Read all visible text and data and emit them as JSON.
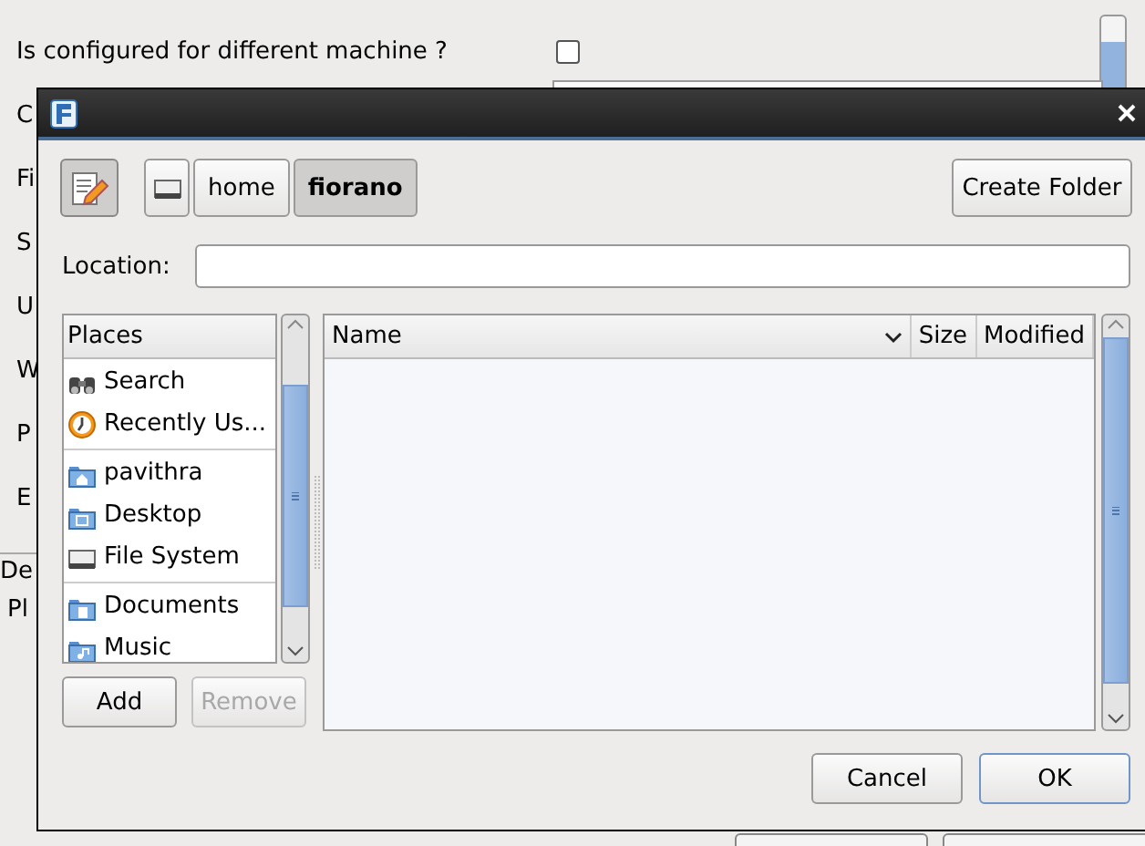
{
  "background": {
    "rows": [
      {
        "label": "Is configured for different machine ?",
        "kind": "checkbox",
        "checked": false
      },
      {
        "label": "C",
        "kind": "text"
      },
      {
        "label": "Fi",
        "kind": "text"
      },
      {
        "label": "S",
        "kind": "text"
      },
      {
        "label": "U",
        "kind": "text"
      },
      {
        "label": "W",
        "kind": "text"
      },
      {
        "label": "P",
        "kind": "text"
      },
      {
        "label": "E",
        "kind": "text"
      }
    ],
    "section_labels": [
      "De",
      "Pl"
    ]
  },
  "dialog": {
    "toolbar": {
      "edit_toggle": {
        "pressed": true
      },
      "path": [
        {
          "kind": "drive",
          "selected": false
        },
        {
          "kind": "text",
          "label": "home",
          "selected": false
        },
        {
          "kind": "text",
          "label": "fiorano",
          "selected": true
        }
      ],
      "create_folder": "Create Folder"
    },
    "location": {
      "label": "Location:"
    },
    "places": {
      "header": "Places",
      "groups": [
        [
          {
            "label": "Search",
            "kind": "search"
          },
          {
            "label": "Recently Us...",
            "kind": "recent"
          }
        ],
        [
          {
            "label": "pavithra",
            "kind": "home-folder"
          },
          {
            "label": "Desktop",
            "kind": "desktop-folder"
          },
          {
            "label": "File System",
            "kind": "drive"
          }
        ],
        [
          {
            "label": "Documents",
            "kind": "documents-folder"
          },
          {
            "label": "Music",
            "kind": "music-folder"
          }
        ]
      ]
    },
    "place_buttons": [
      {
        "label": "Add",
        "disabled": false
      },
      {
        "label": "Remove",
        "disabled": true
      }
    ],
    "files": {
      "columns": [
        {
          "label": "Name",
          "sorted": true
        },
        {
          "label": "Size",
          "sorted": false
        },
        {
          "label": "Modified",
          "sorted": false
        }
      ]
    },
    "buttons": [
      {
        "label": "Cancel",
        "default": false
      },
      {
        "label": "OK",
        "default": true
      }
    ]
  }
}
